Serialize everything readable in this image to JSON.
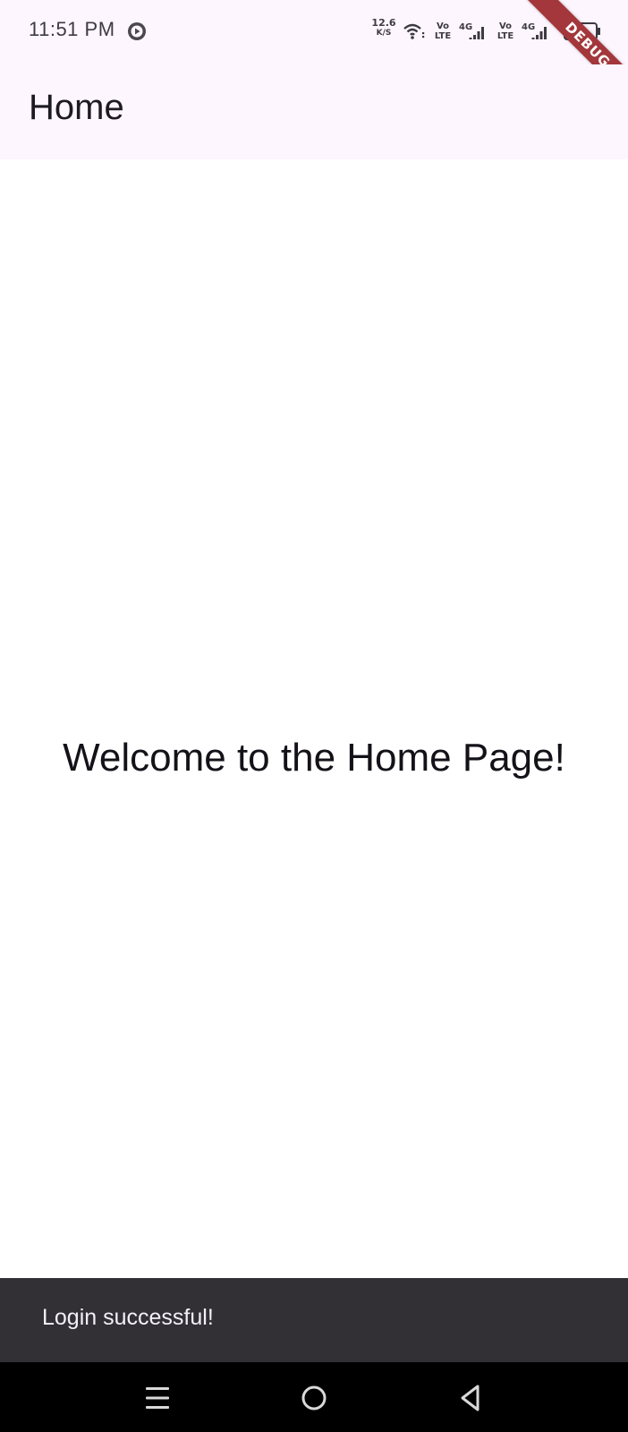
{
  "status_bar": {
    "time": "11:51 PM",
    "net_speed_value": "12.6",
    "net_speed_unit": "K/S",
    "sim1_volte_top": "Vo",
    "sim1_volte_bottom": "LTE",
    "sim1_network": "4G",
    "sim2_volte_top": "Vo",
    "sim2_volte_bottom": "LTE",
    "sim2_network": "4G",
    "icons": [
      "screen-record-icon",
      "wifi-icon",
      "signal-icon",
      "signal-icon",
      "battery-icon"
    ]
  },
  "debug_banner": "DEBUG",
  "app_bar": {
    "title": "Home"
  },
  "main": {
    "welcome": "Welcome to the Home Page!"
  },
  "snackbar": {
    "message": "Login successful!"
  },
  "nav_bar": {
    "icons": [
      "recents-icon",
      "home-icon",
      "back-icon"
    ]
  },
  "colors": {
    "app_bar_bg": "#fdf6fe",
    "snackbar_bg": "#322f35",
    "debug_ribbon": "#a3373b",
    "nav_bg": "#000000"
  }
}
